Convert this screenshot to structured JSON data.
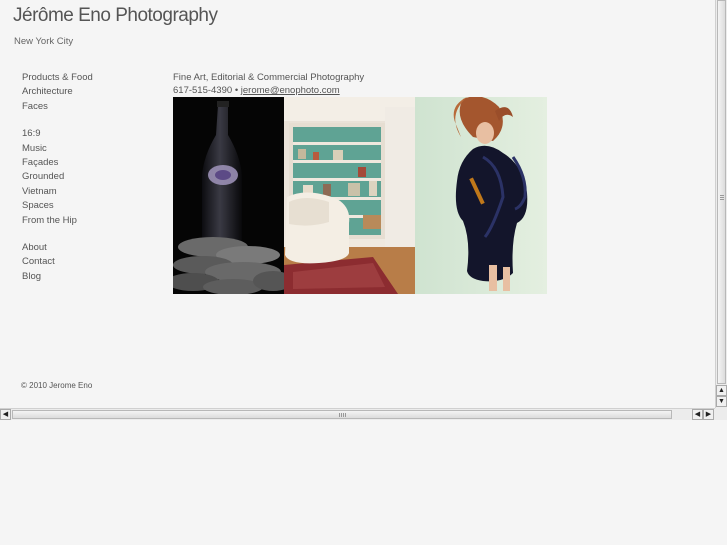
{
  "site": {
    "title": "Jérôme Eno Photography",
    "location": "New York City"
  },
  "nav": {
    "group1": [
      "Products & Food",
      "Architecture",
      "Faces"
    ],
    "group2": [
      "16:9",
      "Music",
      "Façades",
      "Grounded",
      "Vietnam",
      "Spaces",
      "From the Hip"
    ],
    "group3": [
      "About",
      "Contact",
      "Blog"
    ]
  },
  "main": {
    "tagline": "Fine Art, Editorial & Commercial Photography",
    "phone": "617-515-4390",
    "separator": "•",
    "email": "jerome@enophoto.com"
  },
  "footer": {
    "copyright": "© 2010 Jerome Eno"
  },
  "scrollbars": {
    "up_arrow": "▲",
    "down_arrow": "▼",
    "left_arrow": "◀",
    "right_arrow": "▶"
  }
}
